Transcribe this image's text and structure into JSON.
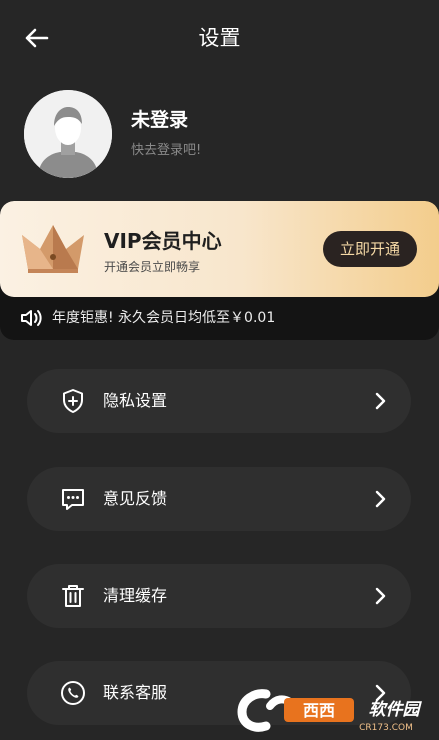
{
  "header": {
    "title": "设置"
  },
  "profile": {
    "name": "未登录",
    "hint": "快去登录吧!"
  },
  "vip": {
    "title": "VIP会员中心",
    "subtitle": "开通会员立即畅享",
    "button_label": "立即开通",
    "promo_text": "年度钜惠! 永久会员日均低至￥0.01"
  },
  "menu": [
    {
      "label": "隐私设置",
      "icon": "shield-plus-icon"
    },
    {
      "label": "意见反馈",
      "icon": "chat-dots-icon"
    },
    {
      "label": "清理缓存",
      "icon": "trash-icon"
    },
    {
      "label": "联系客服",
      "icon": "phone-icon"
    }
  ],
  "watermark": {
    "brand": "西西软件园",
    "site": "CR173.COM"
  },
  "colors": {
    "background": "#262626",
    "menu_item": "#2f2f2f",
    "vip_gradient_start": "#fbf1e3",
    "vip_gradient_end": "#f3cd8c",
    "vip_button": "#2a2321"
  }
}
